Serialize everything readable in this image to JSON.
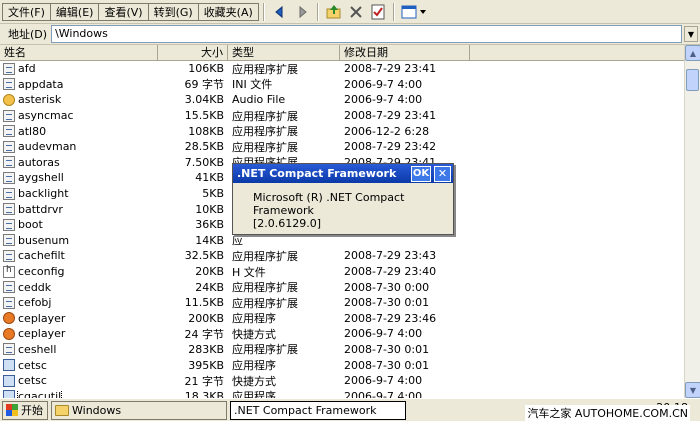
{
  "menu": {
    "items": [
      "文件(F)",
      "编辑(E)",
      "查看(V)",
      "转到(G)",
      "收藏夹(A)"
    ]
  },
  "toolbar": {
    "icons": [
      "back-arrow-icon",
      "forward-arrow-icon",
      "up-folder-icon",
      "delete-icon",
      "properties-icon",
      "view-menu-icon"
    ]
  },
  "address": {
    "label": "地址(D)",
    "value": "\\Windows"
  },
  "columns": {
    "name": "姓名",
    "size": "大小",
    "type": "类型",
    "date": "修改日期"
  },
  "files": [
    {
      "name": "afd",
      "size": "106KB",
      "type": "应用程序扩展",
      "date": "2008-7-29 23:41",
      "icon": "dll"
    },
    {
      "name": "appdata",
      "size": "69 字节",
      "type": "INI 文件",
      "date": "2006-9-7 4:00",
      "icon": "dll"
    },
    {
      "name": "asterisk",
      "size": "3.04KB",
      "type": "Audio File",
      "date": "2006-9-7 4:00",
      "icon": "audio"
    },
    {
      "name": "asyncmac",
      "size": "15.5KB",
      "type": "应用程序扩展",
      "date": "2008-7-29 23:41",
      "icon": "dll"
    },
    {
      "name": "atl80",
      "size": "108KB",
      "type": "应用程序扩展",
      "date": "2006-12-2 6:28",
      "icon": "dll"
    },
    {
      "name": "audevman",
      "size": "28.5KB",
      "type": "应用程序扩展",
      "date": "2008-7-29 23:42",
      "icon": "dll"
    },
    {
      "name": "autoras",
      "size": "7.50KB",
      "type": "应用程序扩展",
      "date": "2008-7-29 23:41",
      "icon": "dll"
    },
    {
      "name": "aygshell",
      "size": "41KB",
      "type": "应",
      "date": "",
      "icon": "dll"
    },
    {
      "name": "backlight",
      "size": "5KB",
      "type": "应",
      "date": "",
      "icon": "dll"
    },
    {
      "name": "battdrvr",
      "size": "10KB",
      "type": "应",
      "date": "",
      "icon": "dll"
    },
    {
      "name": "boot",
      "size": "36KB",
      "type": "HV",
      "date": "",
      "icon": "dll"
    },
    {
      "name": "busenum",
      "size": "14KB",
      "type": "应",
      "date": "",
      "icon": "dll"
    },
    {
      "name": "cachefilt",
      "size": "32.5KB",
      "type": "应用程序扩展",
      "date": "2008-7-29 23:43",
      "icon": "dll"
    },
    {
      "name": "ceconfig",
      "size": "20KB",
      "type": "H 文件",
      "date": "2008-7-29 23:40",
      "icon": "h"
    },
    {
      "name": "ceddk",
      "size": "24KB",
      "type": "应用程序扩展",
      "date": "2008-7-30 0:00",
      "icon": "dll"
    },
    {
      "name": "cefobj",
      "size": "11.5KB",
      "type": "应用程序扩展",
      "date": "2008-7-30 0:01",
      "icon": "dll"
    },
    {
      "name": "ceplayer",
      "size": "200KB",
      "type": "应用程序",
      "date": "2008-7-29 23:46",
      "icon": "media"
    },
    {
      "name": "ceplayer",
      "size": "24 字节",
      "type": "快捷方式",
      "date": "2006-9-7 4:00",
      "icon": "media"
    },
    {
      "name": "ceshell",
      "size": "283KB",
      "type": "应用程序扩展",
      "date": "2008-7-30 0:01",
      "icon": "dll"
    },
    {
      "name": "cetsc",
      "size": "395KB",
      "type": "应用程序",
      "date": "2008-7-30 0:01",
      "icon": "app"
    },
    {
      "name": "cetsc",
      "size": "21 字节",
      "type": "快捷方式",
      "date": "2006-9-7 4:00",
      "icon": "app"
    },
    {
      "name": "cgacutil",
      "size": "18.3KB",
      "type": "应用程序",
      "date": "2006-9-7 4:00",
      "icon": "app"
    },
    {
      "name": "close",
      "size": "134 字节",
      "type": "2BP 文件",
      "date": "2006-9-7 4:00",
      "icon": "dll"
    }
  ],
  "dialog": {
    "title": ".NET Compact Framework",
    "ok_label": "OK",
    "close_glyph": "✕",
    "line1": "Microsoft (R) .NET Compact Framework",
    "line2": "[2.0.6129.0]"
  },
  "taskbar": {
    "start_label": "开始",
    "task1": "Windows",
    "task2": ".NET Compact Framework",
    "clock": "20:18"
  },
  "watermark": "汽车之家 AUTOHOME.COM.CN"
}
